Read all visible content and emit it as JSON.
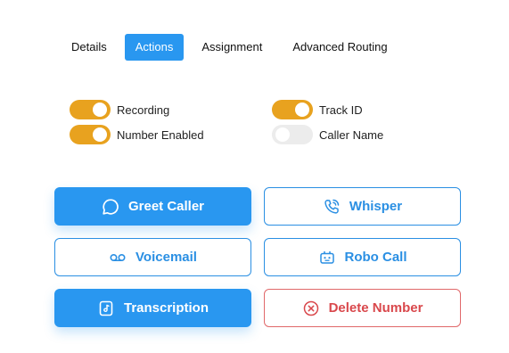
{
  "tabs": [
    {
      "label": "Details",
      "active": false
    },
    {
      "label": "Actions",
      "active": true
    },
    {
      "label": "Assignment",
      "active": false
    },
    {
      "label": "Advanced Routing",
      "active": false
    }
  ],
  "toggles": {
    "recording": {
      "label": "Recording",
      "on": true
    },
    "number_enabled": {
      "label": "Number Enabled",
      "on": true
    },
    "track_id": {
      "label": "Track ID",
      "on": true
    },
    "caller_name": {
      "label": "Caller Name",
      "on": false
    }
  },
  "buttons": {
    "greet_caller": {
      "label": "Greet Caller",
      "icon": "speech-bubble-icon"
    },
    "whisper": {
      "label": "Whisper",
      "icon": "phone-call-icon"
    },
    "voicemail": {
      "label": "Voicemail",
      "icon": "voicemail-icon"
    },
    "robo_call": {
      "label": "Robo Call",
      "icon": "robot-icon"
    },
    "transcription": {
      "label": "Transcription",
      "icon": "document-icon"
    },
    "delete_number": {
      "label": "Delete Number",
      "icon": "close-circle-icon"
    }
  },
  "colors": {
    "primary": "#2997f0",
    "toggle_on": "#e8a21f",
    "toggle_off": "#ececec",
    "danger": "#d9484c"
  }
}
